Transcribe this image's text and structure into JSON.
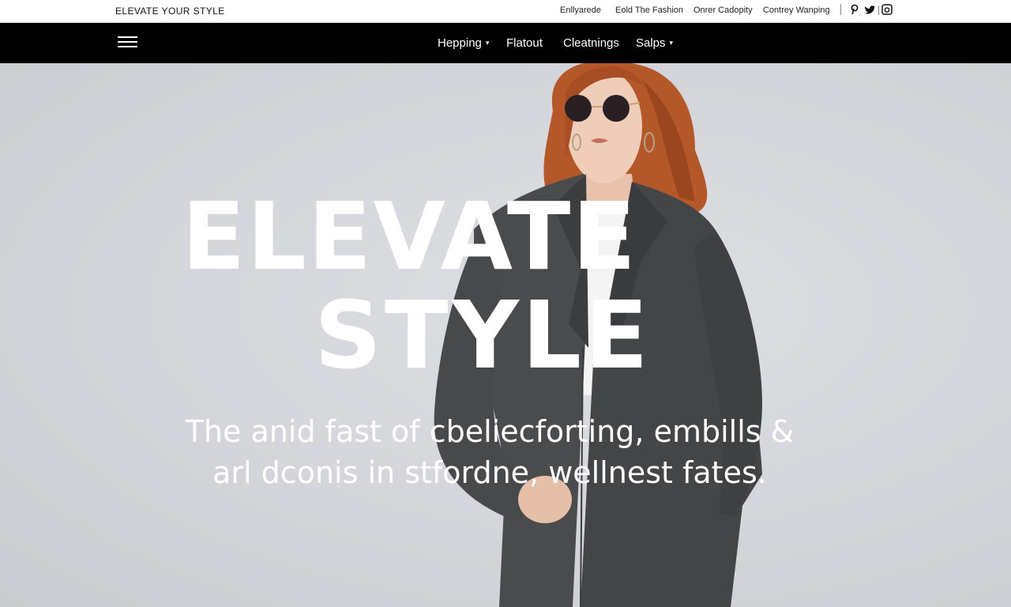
{
  "topbar": {
    "brand": "ELEVATE YOUR STYLE",
    "links": [
      "Enllyarede",
      "Eold The Fashion",
      "Onrer Cadopity",
      "Contrey Wanping"
    ],
    "social_icons": [
      "pinterest-icon",
      "twitter-icon",
      "instagram-icon"
    ]
  },
  "nav": {
    "items": [
      {
        "label": "Hepping",
        "has_dropdown": true
      },
      {
        "label": "Flatout",
        "has_dropdown": false
      },
      {
        "label": "Cleatnings",
        "has_dropdown": false
      },
      {
        "label": "Salps",
        "has_dropdown": true
      }
    ],
    "caret": "▾"
  },
  "hero": {
    "headline_line1": "ELEVATE",
    "headline_line2": "STYLE",
    "subtext_line1": "The anid fast of cbeliecforting, embills &",
    "subtext_line2": "arl dconis in stfordne, wellnest fates."
  },
  "colors": {
    "navbar_bg": "#000000",
    "hero_bg": "#d5d7dc",
    "coat": "#4a4b4d",
    "hair": "#b85a2a",
    "headline": "#ffffff"
  }
}
